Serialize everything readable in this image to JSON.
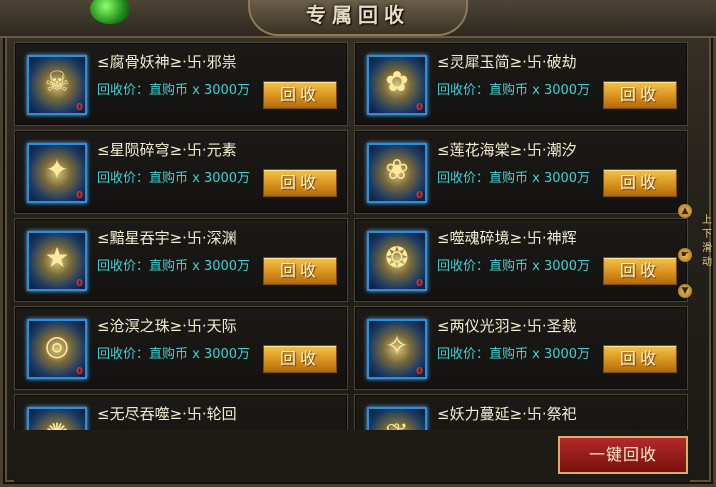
{
  "window": {
    "title": "专属回收"
  },
  "price_label": "回收价：直购币 x 3000万",
  "recycle_label": "回收",
  "one_key_label": "一键回收",
  "side_label": "上下滑动",
  "items": [
    {
      "name": "≤腐骨妖神≥·卐·邪祟",
      "count": "0",
      "icon": "demon-skull-icon"
    },
    {
      "name": "≤灵犀玉简≥·卐·破劫",
      "count": "0",
      "icon": "jade-slip-icon"
    },
    {
      "name": "≤星陨碎穹≥·卐·元素",
      "count": "0",
      "icon": "meteor-icon"
    },
    {
      "name": "≤莲花海棠≥·卐·潮汐",
      "count": "0",
      "icon": "lotus-icon"
    },
    {
      "name": "≤黯星吞宇≥·卐·深渊",
      "count": "0",
      "icon": "dark-star-icon"
    },
    {
      "name": "≤噬魂碎境≥·卐·神辉",
      "count": "0",
      "icon": "soul-mirror-icon"
    },
    {
      "name": "≤沧溟之珠≥·卐·天际",
      "count": "0",
      "icon": "pearl-ring-icon"
    },
    {
      "name": "≤两仪光羽≥·卐·圣裁",
      "count": "0",
      "icon": "feather-icon"
    },
    {
      "name": "≤无尽吞噬≥·卐·轮回",
      "count": "",
      "icon": "devour-icon"
    },
    {
      "name": "≤妖力蔓延≥·卐·祭祀",
      "count": "",
      "icon": "vine-icon"
    }
  ]
}
